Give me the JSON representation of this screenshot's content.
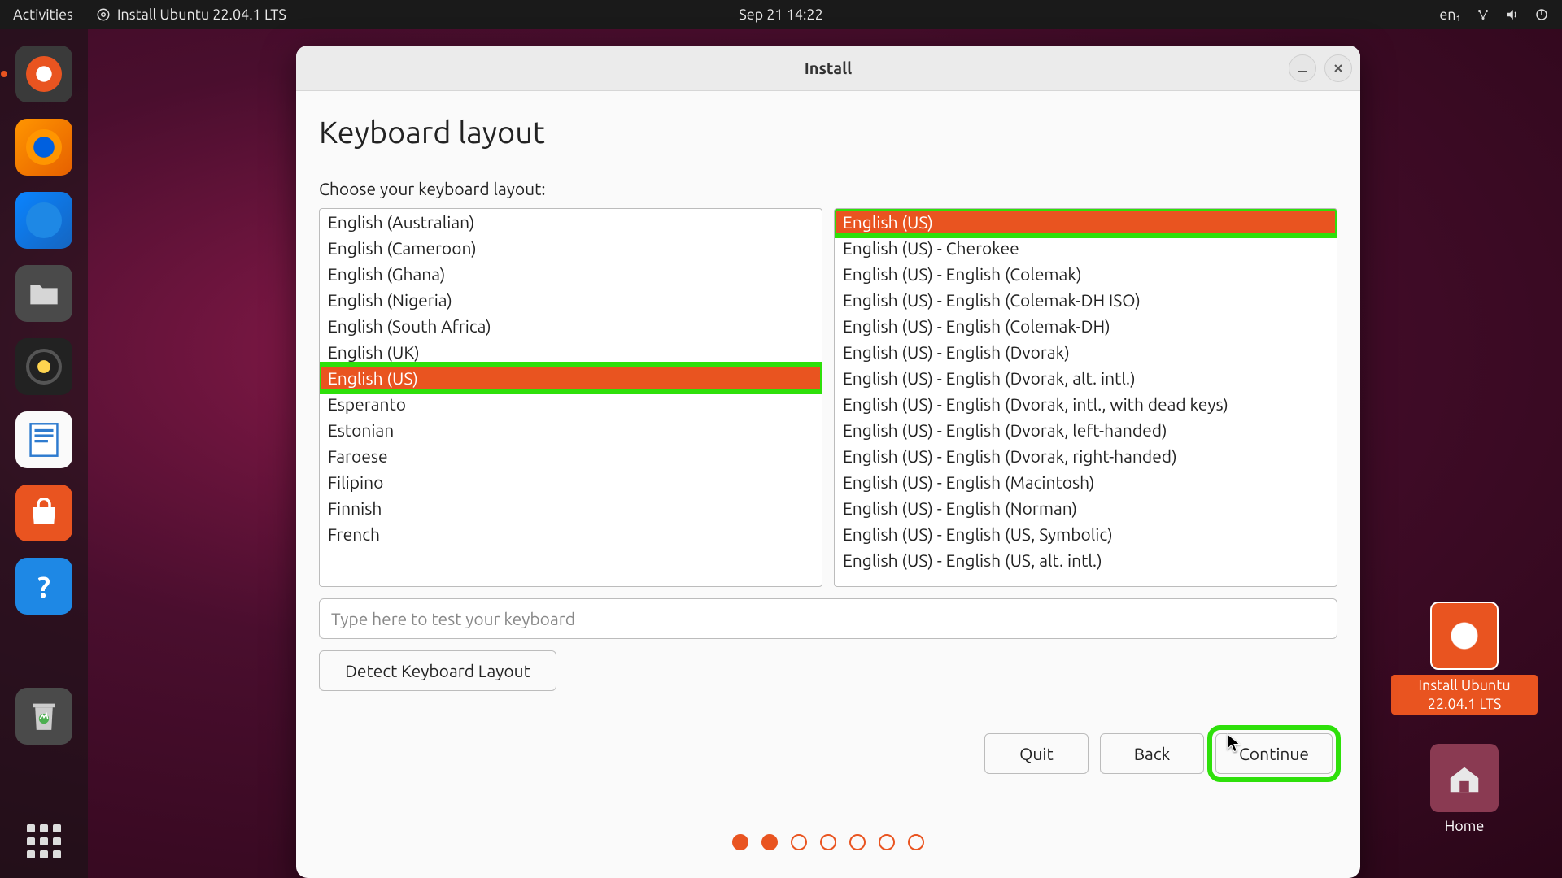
{
  "topbar": {
    "activities": "Activities",
    "install_indicator": "Install Ubuntu 22.04.1 LTS",
    "clock": "Sep 21  14:22",
    "input_lang": "en₁"
  },
  "dock": {
    "items": [
      "ubiquity-installer",
      "firefox",
      "thunderbird",
      "files",
      "rhythmbox",
      "libreoffice-writer",
      "ubuntu-software",
      "help"
    ]
  },
  "desktop_icons": {
    "install_label": "Install Ubuntu 22.04.1 LTS",
    "home_label": "Home"
  },
  "window": {
    "title": "Install",
    "heading": "Keyboard layout",
    "choose_label": "Choose your keyboard layout:",
    "test_placeholder": "Type here to test your keyboard",
    "detect_label": "Detect Keyboard Layout",
    "quit": "Quit",
    "back": "Back",
    "continue": "Continue"
  },
  "left_list": {
    "items": [
      "English (Australian)",
      "English (Cameroon)",
      "English (Ghana)",
      "English (Nigeria)",
      "English (South Africa)",
      "English (UK)",
      "English (US)",
      "Esperanto",
      "Estonian",
      "Faroese",
      "Filipino",
      "Finnish",
      "French"
    ],
    "selected_index": 6
  },
  "right_list": {
    "items": [
      "English (US)",
      "English (US) - Cherokee",
      "English (US) - English (Colemak)",
      "English (US) - English (Colemak-DH ISO)",
      "English (US) - English (Colemak-DH)",
      "English (US) - English (Dvorak)",
      "English (US) - English (Dvorak, alt. intl.)",
      "English (US) - English (Dvorak, intl., with dead keys)",
      "English (US) - English (Dvorak, left-handed)",
      "English (US) - English (Dvorak, right-handed)",
      "English (US) - English (Macintosh)",
      "English (US) - English (Norman)",
      "English (US) - English (US, Symbolic)",
      "English (US) - English (US, alt. intl.)"
    ],
    "selected_index": 0
  },
  "pager": {
    "total": 7,
    "filled": 2
  },
  "colors": {
    "accent": "#e95420",
    "highlight": "#2ee00a"
  }
}
